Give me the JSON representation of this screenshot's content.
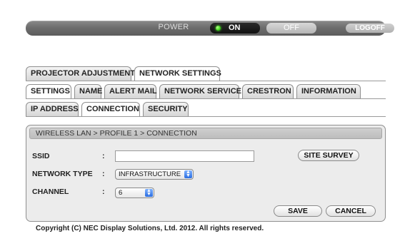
{
  "power": {
    "label": "POWER",
    "on_label": "ON",
    "off_label": "OFF",
    "logoff_label": "LOGOFF",
    "state": "on"
  },
  "tabs_row1": [
    {
      "label": "PROJECTOR ADJUSTMENT",
      "active": false
    },
    {
      "label": "NETWORK SETTINGS",
      "active": true
    }
  ],
  "tabs_row2": [
    {
      "label": "SETTINGS",
      "active": true
    },
    {
      "label": "NAME",
      "active": false
    },
    {
      "label": "ALERT MAIL",
      "active": false
    },
    {
      "label": "NETWORK SERVICE",
      "active": false
    },
    {
      "label": "CRESTRON",
      "active": false
    },
    {
      "label": "INFORMATION",
      "active": false
    }
  ],
  "tabs_row3": [
    {
      "label": "IP ADDRESS",
      "active": false
    },
    {
      "label": "CONNECTION",
      "active": true
    },
    {
      "label": "SECURITY",
      "active": false
    }
  ],
  "panel": {
    "breadcrumb": "WIRELESS LAN > PROFILE 1 > CONNECTION",
    "ssid_label": "SSID",
    "ssid_value": "",
    "colon": ":",
    "site_survey_label": "SITE SURVEY",
    "network_type_label": "NETWORK TYPE",
    "network_type_value": "INFRASTRUCTURE",
    "channel_label": "CHANNEL",
    "channel_value": "6",
    "save_label": "SAVE",
    "cancel_label": "CANCEL"
  },
  "footer": {
    "copyright": "Copyright (C) NEC Display Solutions, Ltd. 2012. All rights reserved."
  },
  "colors": {
    "power_led": "#3bd21a",
    "select_arrow": "#2a6de0"
  },
  "icons": {
    "power_indicator": "led-icon",
    "select_arrows": "updown-arrows-icon"
  }
}
